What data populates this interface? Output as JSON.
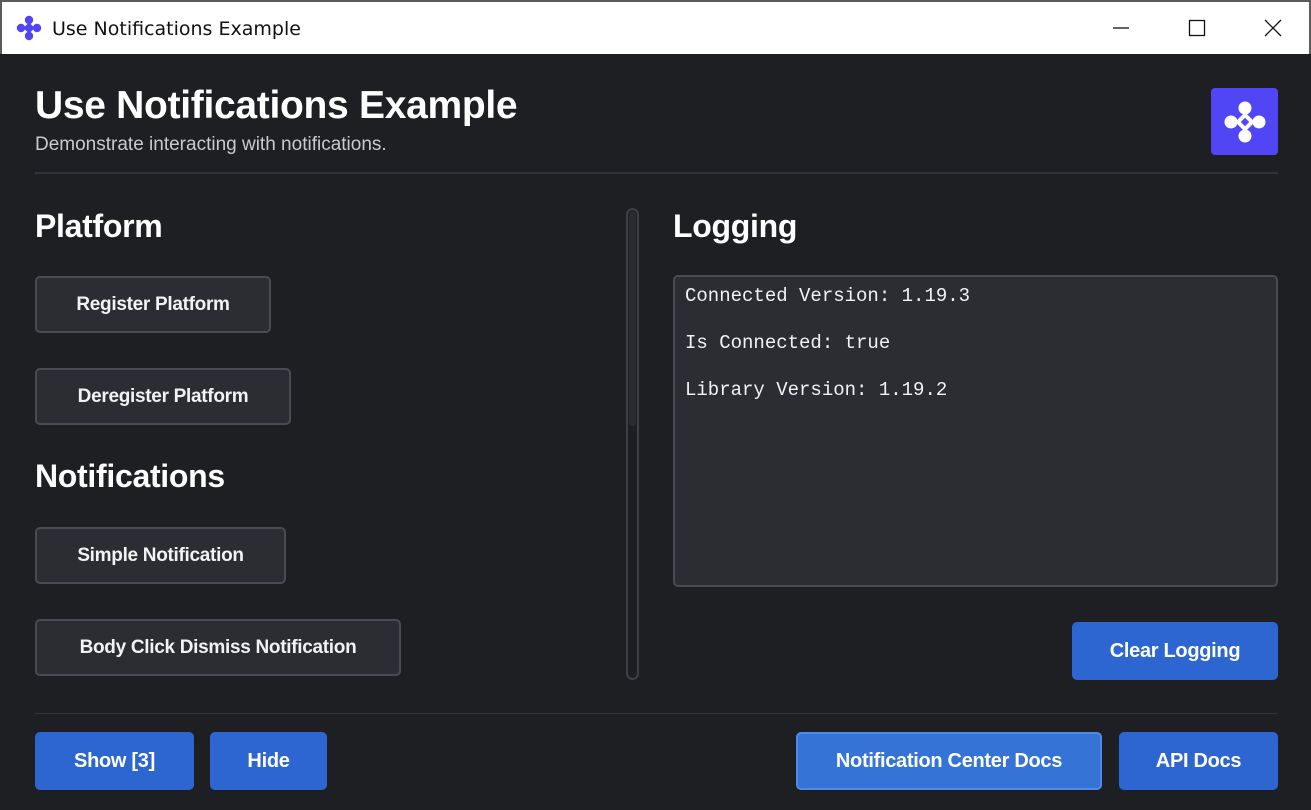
{
  "window": {
    "title": "Use Notifications Example",
    "icon": "app-logo-icon",
    "controls": [
      "minimize-icon",
      "maximize-icon",
      "close-icon"
    ]
  },
  "header": {
    "title": "Use Notifications Example",
    "subtitle": "Demonstrate interacting with notifications.",
    "logo": "brand-logo-icon"
  },
  "platform": {
    "heading": "Platform",
    "register_label": "Register Platform",
    "deregister_label": "Deregister Platform"
  },
  "notifications": {
    "heading": "Notifications",
    "simple_label": "Simple Notification",
    "body_click_label": "Body Click Dismiss Notification"
  },
  "logging": {
    "heading": "Logging",
    "lines": [
      "Connected Version: 1.19.3",
      "Is Connected: true",
      "Library Version: 1.19.2"
    ],
    "clear_label": "Clear Logging"
  },
  "footer": {
    "show_label": "Show [3]",
    "hide_label": "Hide",
    "nc_docs_label": "Notification Center Docs",
    "api_docs_label": "API Docs"
  },
  "colors": {
    "background": "#1e1f22",
    "panel": "#2c2d33",
    "accent_blue": "#2d66d0",
    "brand_purple": "#5046f5"
  }
}
